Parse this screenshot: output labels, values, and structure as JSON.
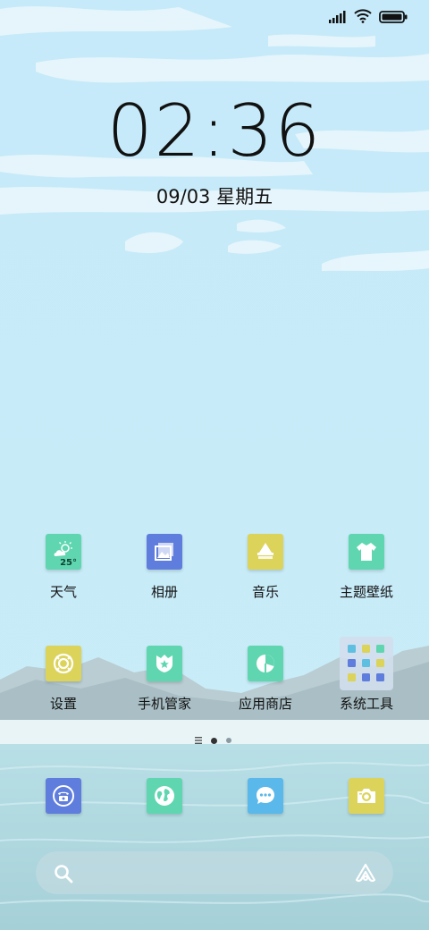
{
  "status_bar": {
    "signal_icon": "signal-bars-icon",
    "wifi_icon": "wifi-icon",
    "battery_icon": "battery-icon"
  },
  "clock": {
    "time": "02:36",
    "date": "09/03 星期五"
  },
  "apps": [
    {
      "label": "天气",
      "icon": "weather-icon",
      "color": "#5fd6b0",
      "badge": "25°"
    },
    {
      "label": "相册",
      "icon": "gallery-icon",
      "color": "#5f7ddc"
    },
    {
      "label": "音乐",
      "icon": "music-icon",
      "color": "#dcd35a"
    },
    {
      "label": "主题壁纸",
      "icon": "shirt-icon",
      "color": "#5fd6b0"
    },
    {
      "label": "设置",
      "icon": "settings-icon",
      "color": "#dcd35a"
    },
    {
      "label": "手机管家",
      "icon": "shield-icon",
      "color": "#5fd6b0"
    },
    {
      "label": "应用商店",
      "icon": "app-store-icon",
      "color": "#5fd6b0"
    },
    {
      "label": "系统工具",
      "icon": "folder-icon",
      "color": "#d0d8e4"
    }
  ],
  "dock": [
    {
      "name": "phone",
      "icon": "phone-icon",
      "color": "#5f7ddc"
    },
    {
      "name": "browser",
      "icon": "globe-icon",
      "color": "#5fd6b0"
    },
    {
      "name": "messages",
      "icon": "chat-icon",
      "color": "#5ab8ea"
    },
    {
      "name": "camera",
      "icon": "camera-icon",
      "color": "#dcd35a"
    }
  ],
  "search": {
    "left_icon": "search-icon",
    "right_icon": "assistant-icon"
  }
}
